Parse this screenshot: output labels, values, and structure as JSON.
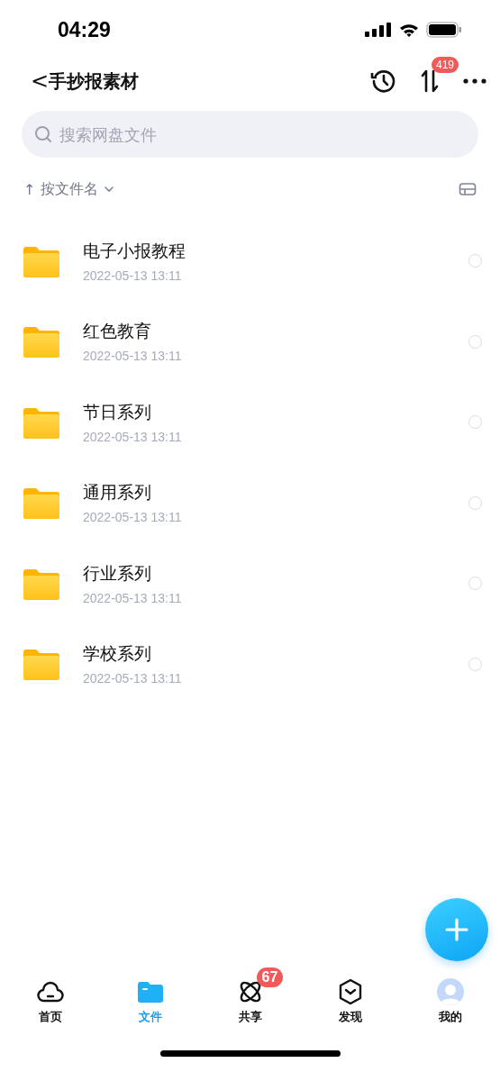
{
  "status_bar": {
    "time": "04:29"
  },
  "header": {
    "back": "<",
    "title": "手抄报素材",
    "transfer_badge": "419"
  },
  "search": {
    "placeholder": "搜索网盘文件"
  },
  "sort": {
    "arrow": "↑",
    "label": "按文件名"
  },
  "files": [
    {
      "name": "电子小报教程",
      "date": "2022-05-13 13:11",
      "selected": false
    },
    {
      "name": "红色教育",
      "date": "2022-05-13 13:11",
      "selected": false
    },
    {
      "name": "节日系列",
      "date": "2022-05-13 13:11",
      "selected": false
    },
    {
      "name": "通用系列",
      "date": "2022-05-13 13:11",
      "selected": false
    },
    {
      "name": "行业系列",
      "date": "2022-05-13 13:11",
      "selected": false
    },
    {
      "name": "学校系列",
      "date": "2022-05-13 13:11",
      "selected": false
    }
  ],
  "tabs": [
    {
      "kind": "home",
      "label": "首页",
      "selected": false
    },
    {
      "kind": "files",
      "label": "文件",
      "selected": true
    },
    {
      "kind": "share",
      "label": "共享",
      "selected": false,
      "badge": "67"
    },
    {
      "kind": "discover",
      "label": "发现",
      "selected": false
    },
    {
      "kind": "me",
      "label": "我的",
      "selected": false
    }
  ]
}
